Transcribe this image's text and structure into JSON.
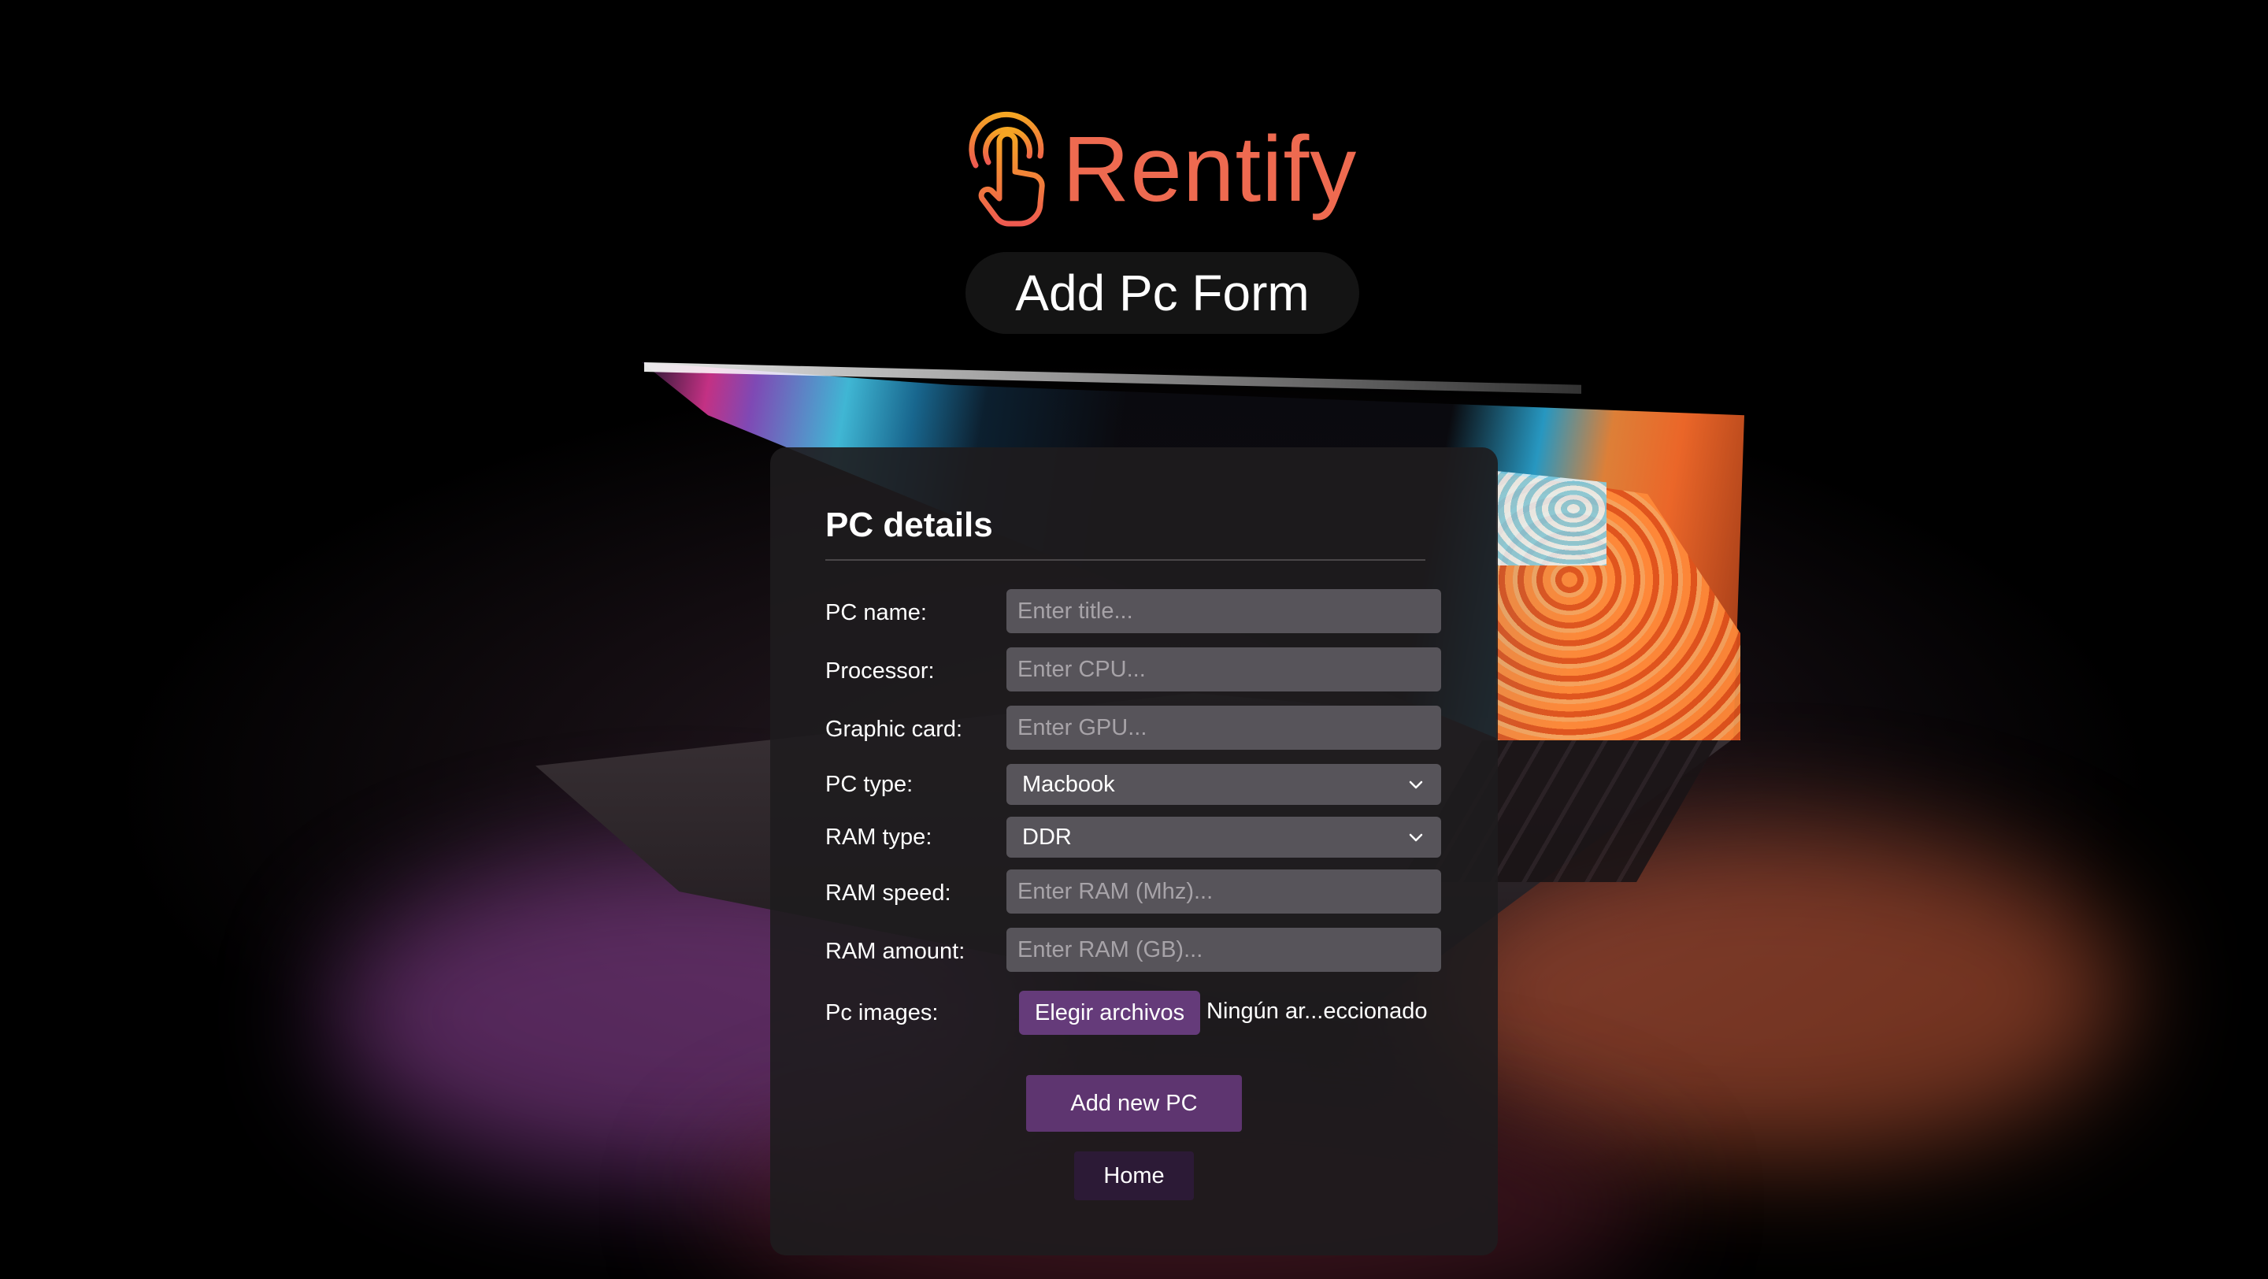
{
  "brand": {
    "name": "Rentify"
  },
  "header": {
    "title": "Add Pc Form"
  },
  "form": {
    "title": "PC details",
    "fields": [
      {
        "label": "PC name:",
        "placeholder": "Enter title..."
      },
      {
        "label": "Processor:",
        "placeholder": "Enter CPU..."
      },
      {
        "label": "Graphic card:",
        "placeholder": "Enter GPU..."
      },
      {
        "label": "PC type:",
        "selected": "Macbook"
      },
      {
        "label": "RAM type:",
        "selected": "DDR"
      },
      {
        "label": "RAM speed:",
        "placeholder": "Enter RAM (Mhz)..."
      },
      {
        "label": "RAM amount:",
        "placeholder": "Enter RAM (GB)..."
      }
    ],
    "images": {
      "label": "Pc images:",
      "button": "Elegir archivos",
      "status": "Ningún ar...eccionado"
    },
    "submit_label": "Add new PC",
    "home_label": "Home"
  },
  "colors": {
    "brand": "#ee6a50",
    "accent": "#5e3570",
    "panel": "#1e1c1e",
    "field": "#57545a"
  },
  "icons": {
    "brand": "touch-hand-icon",
    "select": "chevron-down-icon"
  }
}
